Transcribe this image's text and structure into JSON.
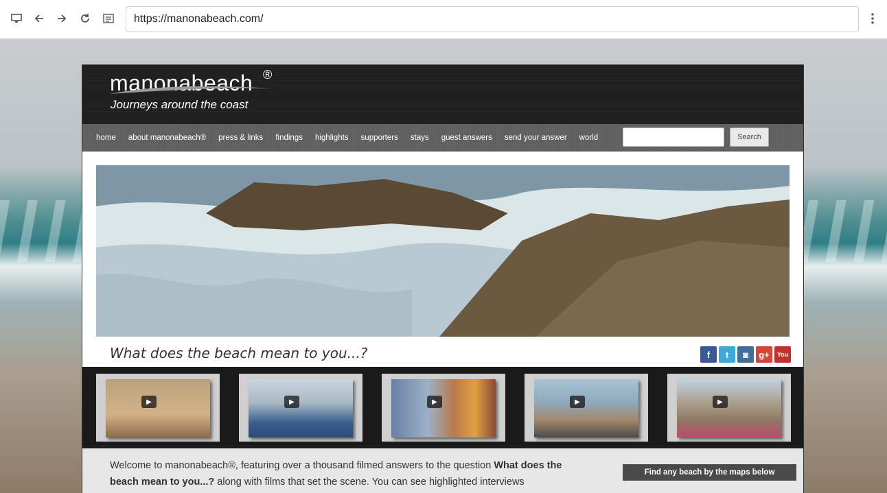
{
  "browser": {
    "url": "https://manonabeach.com/"
  },
  "site": {
    "logo": "manonabeach",
    "logo_reg": "®",
    "tagline_logo": "Journeys around the coast",
    "nav": [
      "home",
      "about manonabeach®",
      "press & links",
      "findings",
      "highlights",
      "supporters",
      "stays",
      "guest answers",
      "send your answer",
      "world"
    ],
    "search_button": "Search",
    "headline": "What does the beach mean to you...?",
    "social_icons": [
      "facebook-icon",
      "twitter-icon",
      "instagram-icon",
      "google-plus-icon",
      "youtube-icon"
    ],
    "welcome_text_part1": "Welcome to manonabeach®, featuring over a thousand filmed answers to the question ",
    "welcome_text_bold": "What does the beach mean to you...?",
    "welcome_text_part2": " along with films that set the scene.  You can see highlighted interviews",
    "map_box": "Find any beach by the maps below"
  },
  "colors": {
    "header_bg": "#1e1e1e",
    "nav_bg": "#5f5f5f",
    "strip_bg": "#1a1a1a"
  }
}
